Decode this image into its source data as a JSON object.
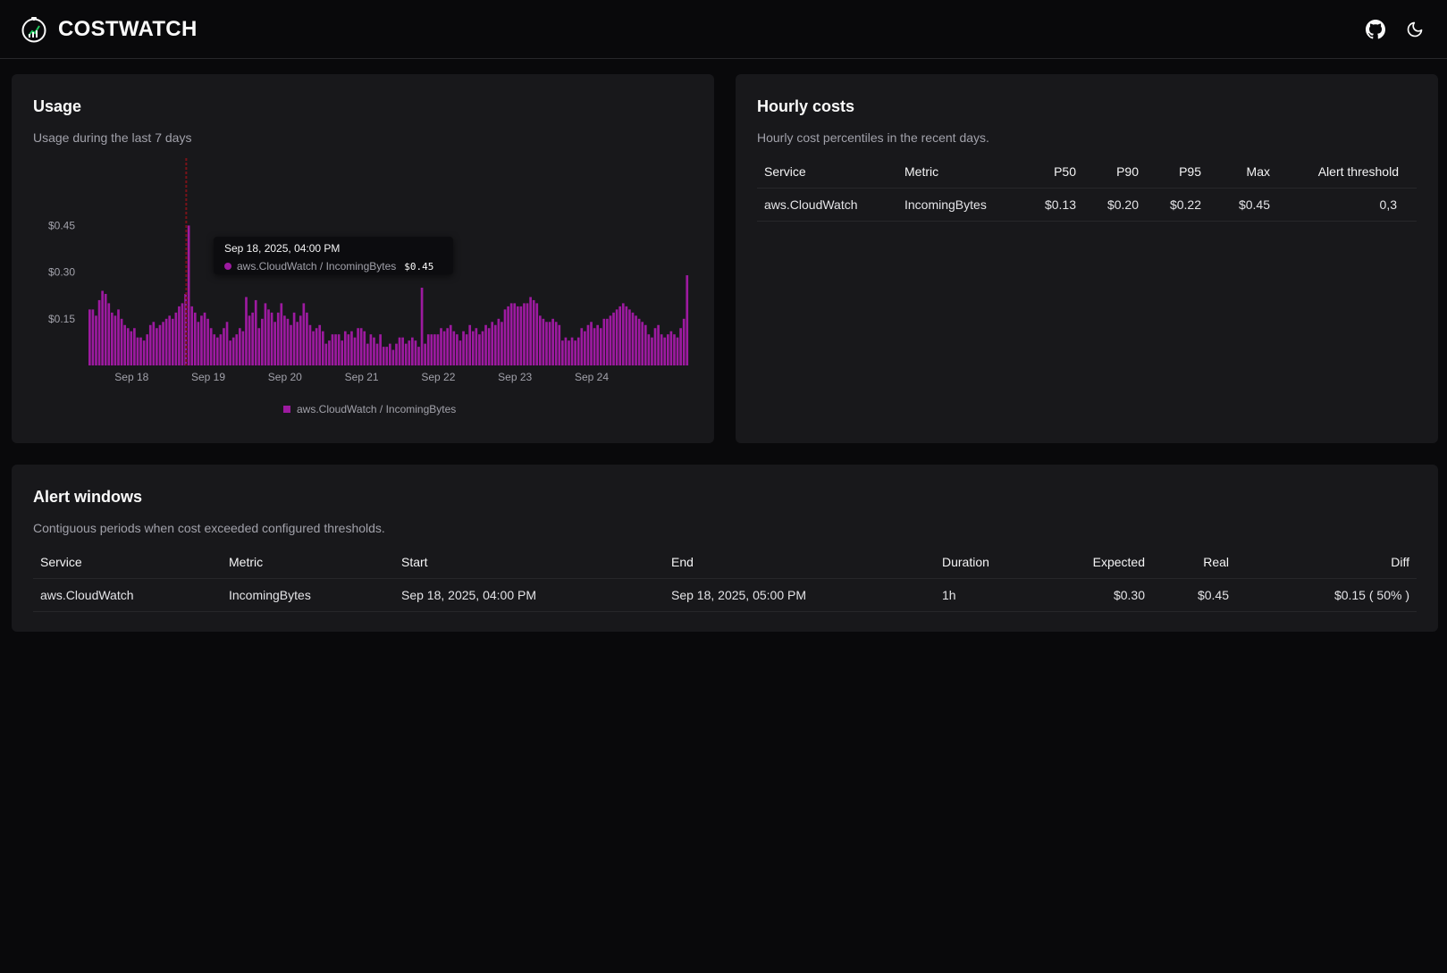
{
  "app": {
    "title": "COSTWATCH"
  },
  "header": {
    "github_icon": "github-icon",
    "theme_icon": "moon-icon"
  },
  "usage": {
    "title": "Usage",
    "description": "Usage during the last 7 days",
    "tooltip": {
      "time": "Sep 18, 2025, 04:00 PM",
      "series": "aws.CloudWatch / IncomingBytes",
      "value": "$0.45"
    },
    "legend": "aws.CloudWatch / IncomingBytes"
  },
  "chart_data": {
    "type": "bar",
    "title": "",
    "xlabel": "",
    "ylabel": "",
    "y_ticks": [
      "$0.15",
      "$0.30",
      "$0.45"
    ],
    "y_tick_values": [
      0.15,
      0.3,
      0.45
    ],
    "x_ticks": [
      "Sep 18",
      "Sep 19",
      "Sep 20",
      "Sep 21",
      "Sep 22",
      "Sep 23",
      "Sep 24"
    ],
    "ylim": [
      0,
      0.6
    ],
    "legend_position": "bottom",
    "color": "#9d1aa0",
    "highlight_color": "#7a1218",
    "highlight_index": 27,
    "series": [
      {
        "name": "aws.CloudWatch / IncomingBytes",
        "values": [
          0.18,
          0.18,
          0.16,
          0.21,
          0.24,
          0.23,
          0.2,
          0.17,
          0.16,
          0.18,
          0.15,
          0.13,
          0.12,
          0.11,
          0.12,
          0.09,
          0.09,
          0.08,
          0.1,
          0.13,
          0.14,
          0.12,
          0.13,
          0.14,
          0.15,
          0.16,
          0.15,
          0.17,
          0.19,
          0.2,
          0.23,
          0.45,
          0.19,
          0.17,
          0.14,
          0.16,
          0.17,
          0.15,
          0.12,
          0.1,
          0.09,
          0.1,
          0.12,
          0.14,
          0.08,
          0.09,
          0.1,
          0.12,
          0.11,
          0.22,
          0.16,
          0.17,
          0.21,
          0.12,
          0.15,
          0.2,
          0.18,
          0.17,
          0.14,
          0.17,
          0.2,
          0.16,
          0.15,
          0.13,
          0.17,
          0.14,
          0.16,
          0.2,
          0.17,
          0.13,
          0.11,
          0.12,
          0.13,
          0.11,
          0.07,
          0.08,
          0.1,
          0.1,
          0.1,
          0.08,
          0.11,
          0.1,
          0.11,
          0.09,
          0.12,
          0.12,
          0.11,
          0.07,
          0.1,
          0.09,
          0.07,
          0.1,
          0.06,
          0.06,
          0.07,
          0.05,
          0.07,
          0.09,
          0.09,
          0.07,
          0.08,
          0.09,
          0.08,
          0.06,
          0.25,
          0.07,
          0.1,
          0.1,
          0.1,
          0.1,
          0.12,
          0.11,
          0.12,
          0.13,
          0.11,
          0.1,
          0.08,
          0.11,
          0.1,
          0.13,
          0.11,
          0.12,
          0.1,
          0.11,
          0.13,
          0.12,
          0.14,
          0.13,
          0.15,
          0.14,
          0.18,
          0.19,
          0.2,
          0.2,
          0.19,
          0.19,
          0.2,
          0.2,
          0.22,
          0.21,
          0.2,
          0.16,
          0.15,
          0.14,
          0.14,
          0.15,
          0.14,
          0.13,
          0.08,
          0.09,
          0.08,
          0.09,
          0.08,
          0.09,
          0.12,
          0.11,
          0.13,
          0.14,
          0.12,
          0.13,
          0.12,
          0.15,
          0.15,
          0.16,
          0.17,
          0.18,
          0.19,
          0.2,
          0.19,
          0.18,
          0.17,
          0.16,
          0.15,
          0.14,
          0.13,
          0.1,
          0.09,
          0.12,
          0.13,
          0.1,
          0.09,
          0.1,
          0.11,
          0.1,
          0.09,
          0.12,
          0.15,
          0.29
        ]
      }
    ]
  },
  "hourly": {
    "title": "Hourly costs",
    "description": "Hourly cost percentiles in the recent days.",
    "columns": [
      "Service",
      "Metric",
      "P50",
      "P90",
      "P95",
      "Max",
      "Alert threshold"
    ],
    "rows": [
      [
        "aws.CloudWatch",
        "IncomingBytes",
        "$0.13",
        "$0.20",
        "$0.22",
        "$0.45",
        "0,3"
      ]
    ]
  },
  "alerts": {
    "title": "Alert windows",
    "description": "Contiguous periods when cost exceeded configured thresholds.",
    "columns": [
      "Service",
      "Metric",
      "Start",
      "End",
      "Duration",
      "Expected",
      "Real",
      "Diff"
    ],
    "rows": [
      [
        "aws.CloudWatch",
        "IncomingBytes",
        "Sep 18, 2025, 04:00 PM",
        "Sep 18, 2025, 05:00 PM",
        "1h",
        "$0.30",
        "$0.45",
        "$0.15 ( 50% )"
      ]
    ]
  }
}
